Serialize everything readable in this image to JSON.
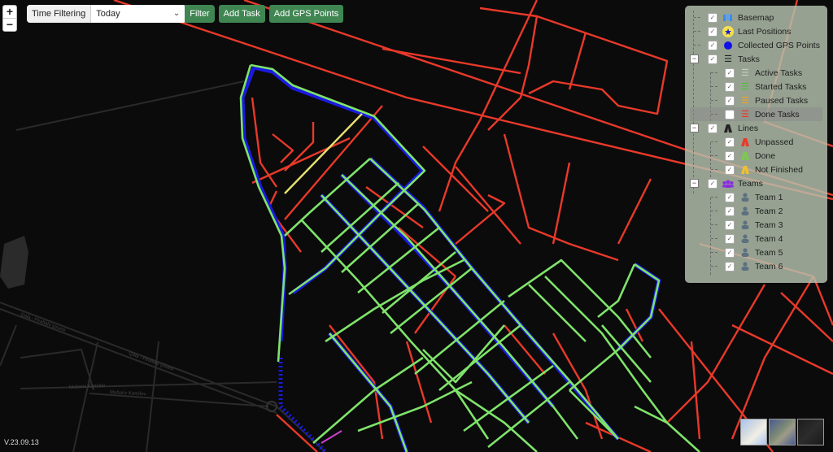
{
  "map": {
    "street_labels": [
      "Qala - Pirallahi şosesi",
      "Qala - Pirallahi şosesi",
      "Mubariz Kamilov",
      "Mubariz Kamilov"
    ],
    "colors": {
      "background": "#0b0b0b",
      "unpassed": "#e8392a",
      "done": "#7fe36b",
      "not_finished": "#e6d44a",
      "gps_points": "#1010e8"
    }
  },
  "zoom_controls": {
    "zoom_in": "+",
    "zoom_out": "−"
  },
  "toolbar": {
    "time_filter_label": "Time Filtering",
    "time_filter_value": "Today",
    "filter_button": "Filter",
    "add_task_button": "Add Task",
    "add_gps_button": "Add GPS Points"
  },
  "legend": {
    "items": [
      {
        "label": "Basemap",
        "checked": true,
        "icon": "map-icon"
      },
      {
        "label": "Last Positions",
        "checked": true,
        "icon": "star-icon"
      },
      {
        "label": "Collected GPS Points",
        "checked": true,
        "icon": "dot-icon"
      },
      {
        "label": "Tasks",
        "checked": true,
        "icon": "list-icon",
        "children": [
          {
            "label": "Active Tasks",
            "checked": true,
            "icon": "list-icon"
          },
          {
            "label": "Started Tasks",
            "checked": true,
            "icon": "list-icon"
          },
          {
            "label": "Paused Tasks",
            "checked": true,
            "icon": "list-icon"
          },
          {
            "label": "Done Tasks",
            "checked": false,
            "icon": "list-icon"
          }
        ]
      },
      {
        "label": "Lines",
        "checked": true,
        "icon": "road-icon",
        "children": [
          {
            "label": "Unpassed",
            "checked": true,
            "icon": "road-icon"
          },
          {
            "label": "Done",
            "checked": true,
            "icon": "road-icon"
          },
          {
            "label": "Not Finished",
            "checked": true,
            "icon": "road-icon"
          }
        ]
      },
      {
        "label": "Teams",
        "checked": true,
        "icon": "users-icon",
        "children": [
          {
            "label": "Team 1",
            "checked": true,
            "icon": "user-icon"
          },
          {
            "label": "Team 2",
            "checked": true,
            "icon": "user-icon"
          },
          {
            "label": "Team 3",
            "checked": true,
            "icon": "user-icon"
          },
          {
            "label": "Team 4",
            "checked": true,
            "icon": "user-icon"
          },
          {
            "label": "Team 5",
            "checked": true,
            "icon": "user-icon"
          },
          {
            "label": "Team 6",
            "checked": true,
            "icon": "user-icon"
          }
        ]
      }
    ]
  },
  "basemaps": [
    "Street",
    "Satellite",
    "Dark"
  ],
  "version": "V.23.09.13"
}
